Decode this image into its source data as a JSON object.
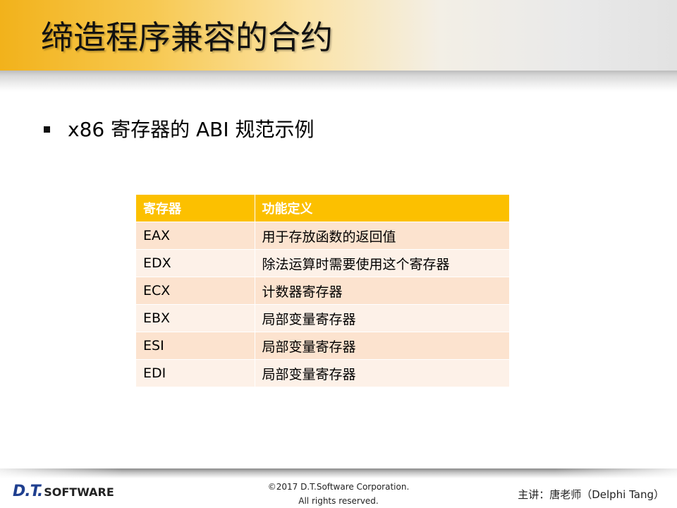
{
  "slide": {
    "title": "缔造程序兼容的合约",
    "bullet": "x86 寄存器的 ABI 规范示例"
  },
  "table": {
    "headers": [
      "寄存器",
      "功能定义"
    ],
    "rows": [
      [
        "EAX",
        "用于存放函数的返回值"
      ],
      [
        "EDX",
        "除法运算时需要使用这个寄存器"
      ],
      [
        "ECX",
        "计数器寄存器"
      ],
      [
        "EBX",
        "局部变量寄存器"
      ],
      [
        "ESI",
        "局部变量寄存器"
      ],
      [
        "EDI",
        "局部变量寄存器"
      ]
    ]
  },
  "footer": {
    "logo_mark": "D.T.",
    "logo_word": "SOFTWARE",
    "copyright_line1": "©2017 D.T.Software Corporation.",
    "copyright_line2": "All rights reserved.",
    "presenter": "主讲：唐老师（Delphi Tang）"
  },
  "colors": {
    "header_fill": "#fcc000",
    "row_odd": "#fce3cf",
    "row_even": "#fdf1e8",
    "title_band": "#f2b21b"
  }
}
